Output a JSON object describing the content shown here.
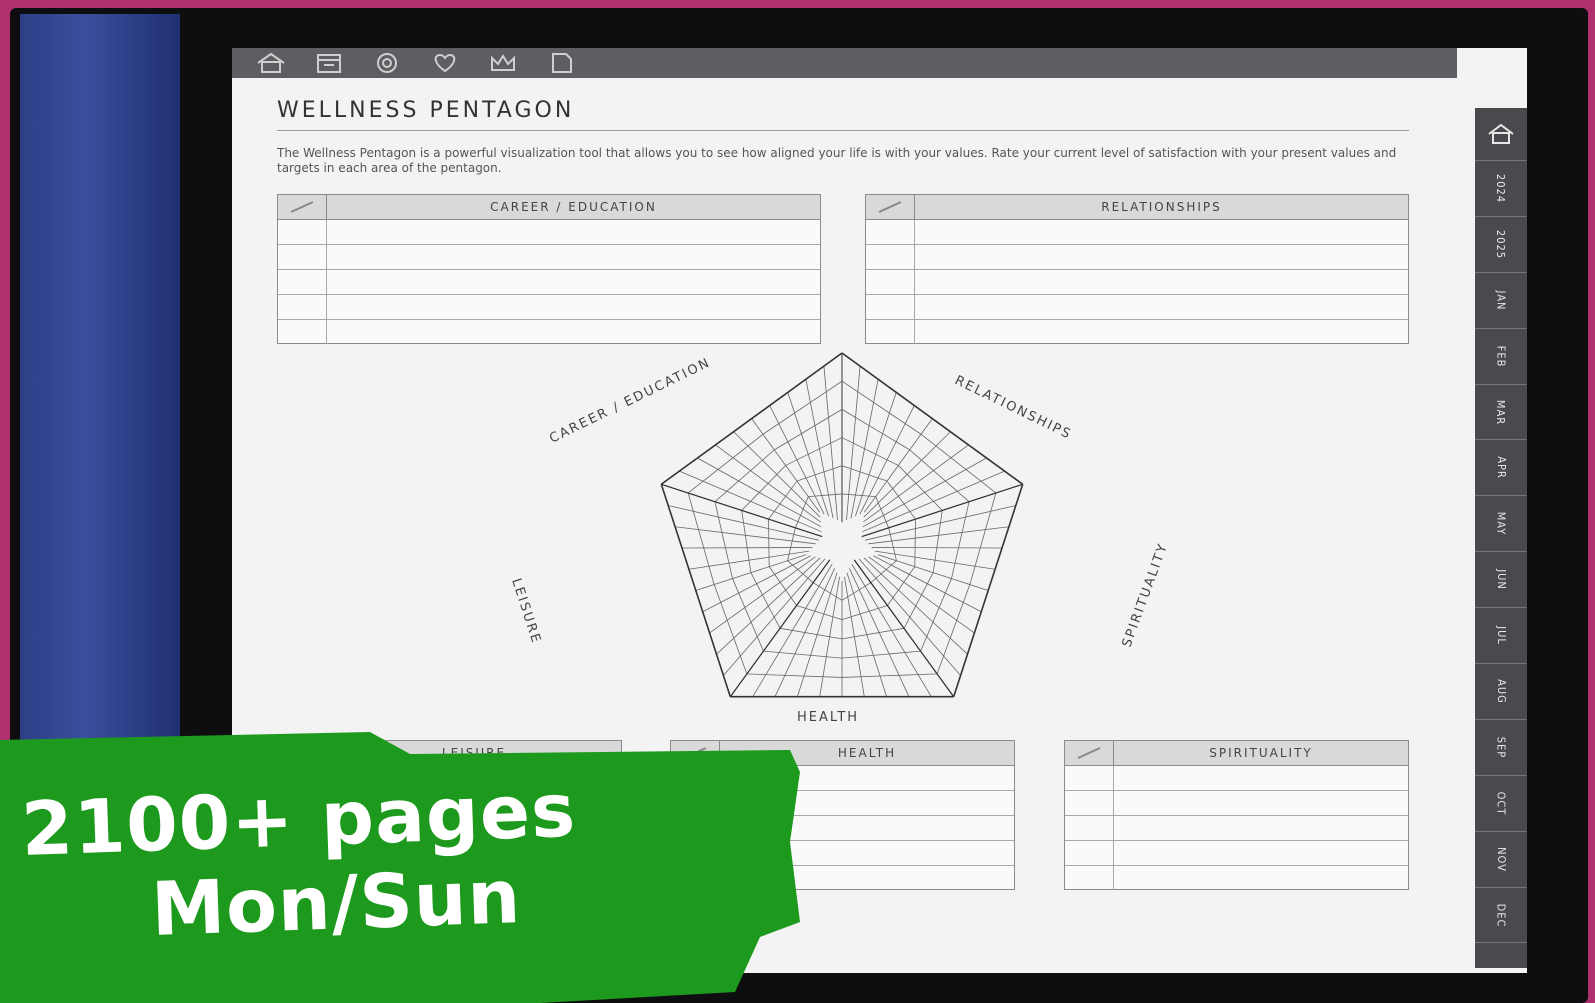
{
  "toolbar": {
    "icons": [
      "home-icon",
      "calendar-icon",
      "target-icon",
      "heart-icon",
      "crown-icon",
      "note-icon"
    ]
  },
  "page": {
    "title": "WELLNESS PENTAGON",
    "description": "The Wellness Pentagon is a powerful visualization tool that allows you to see how aligned your life is with your values. Rate your current level of satisfaction with your present values and targets in each area of the pentagon."
  },
  "tables": {
    "career": "CAREER / EDUCATION",
    "relationships": "RELATIONSHIPS",
    "leisure": "LEISURE",
    "health": "HEALTH",
    "spirituality": "SPIRITUALITY"
  },
  "pentagon": {
    "labels": {
      "career": "CAREER / EDUCATION",
      "relationships": "RELATIONSHIPS",
      "spirituality": "SPIRITUALITY",
      "health": "HEALTH",
      "leisure": "LEISURE"
    }
  },
  "sidebar": {
    "tabs": [
      "2024",
      "2025",
      "JAN",
      "FEB",
      "MAR",
      "APR",
      "MAY",
      "JUN",
      "JUL",
      "AUG",
      "SEP",
      "OCT",
      "NOV",
      "DEC"
    ]
  },
  "promo": {
    "line1": "2100+ pages",
    "line2": "Mon/Sun",
    "color": "#1d9a1d"
  }
}
